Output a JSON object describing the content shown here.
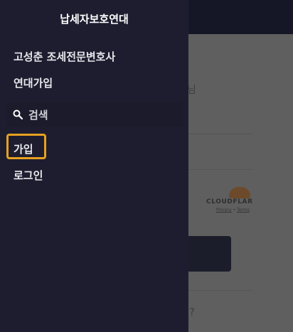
{
  "drawer": {
    "title": "납세자보호연대",
    "items": [
      {
        "label": "고성춘 조세전문변호사"
      },
      {
        "label": "연대가입"
      }
    ],
    "search": {
      "placeholder": "검색"
    },
    "auth": [
      {
        "label": "가입"
      },
      {
        "label": "로그인"
      }
    ]
  },
  "background": {
    "cloudflare": {
      "name": "CLOUDFLAR",
      "privacy": "Privacy",
      "terms": "Terms"
    },
    "fragment_right": "님",
    "fragment_bottom": "?"
  },
  "colors": {
    "drawer_bg": "#1e1d30",
    "highlight": "#e6a11f",
    "overlay": "#5f5f5f"
  }
}
